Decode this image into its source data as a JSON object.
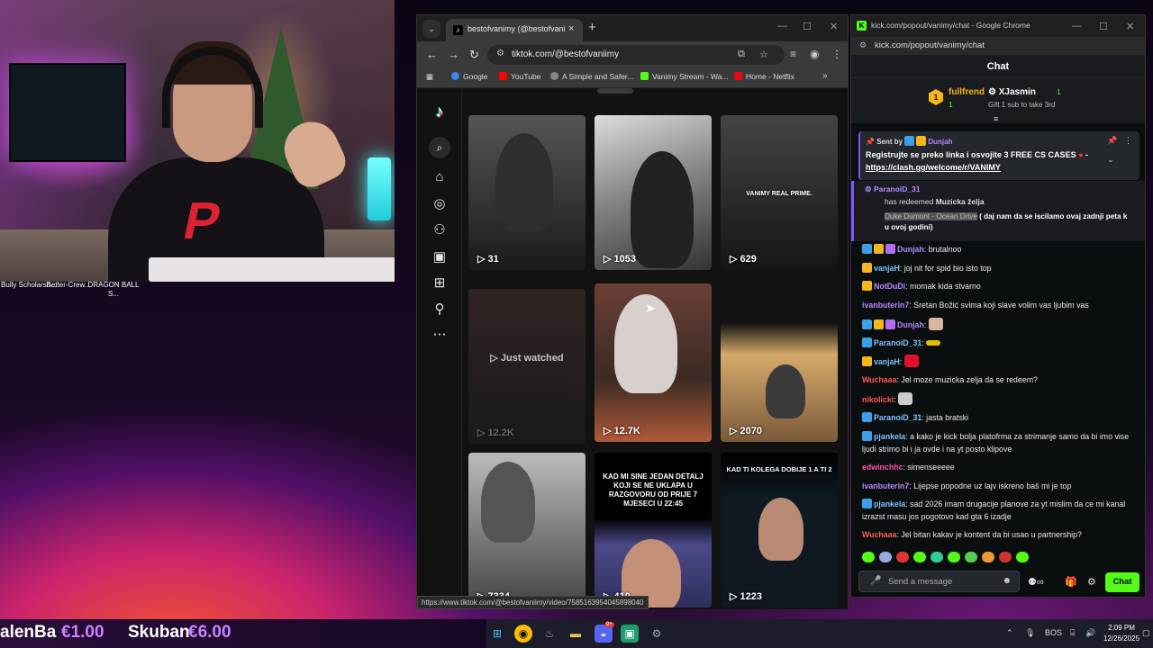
{
  "desktop": {
    "icons": [
      {
        "label": "Bully Scholarsh..."
      },
      {
        "label": "Better-Crew..."
      },
      {
        "label": "DRAGON BALL S..."
      }
    ]
  },
  "tiktok_window": {
    "tab_title": "bestofvanimy (@bestofvanimy",
    "url": "tiktok.com/@bestofvaniimy",
    "bookmarks": [
      "Google",
      "YouTube",
      "A Simple and Safer...",
      "Vanimy Stream - Wa...",
      "Home - Netflix"
    ],
    "videos": [
      {
        "views": "31",
        "overlay": ""
      },
      {
        "views": "1053",
        "overlay": ""
      },
      {
        "views": "629",
        "overlay": "VANIMY REAL PRIME."
      },
      {
        "views": "12.2K",
        "overlay": "Just watched"
      },
      {
        "views": "12.7K",
        "overlay": ""
      },
      {
        "views": "2070",
        "overlay": ""
      },
      {
        "views": "7334",
        "overlay": ""
      },
      {
        "views": "410",
        "overlay": "KAD MI SINE JEDAN DETALJ KOJI SE NE UKLAPA U RAZGOVORU OD PRIJE 7 MJESECI U 22:45"
      },
      {
        "views": "1223",
        "overlay": "KAD TI KOLEGA DOBIJE 1 A TI 2"
      }
    ],
    "status_url": "https://www.tiktok.com/@bestofvaniimy/video/7585163954045898040"
  },
  "kick_window": {
    "title": "kick.com/popout/vanimy/chat - Google Chrome",
    "url": "kick.com/popout/vanimy/chat",
    "chat_header": "Chat",
    "leaderboard": {
      "first": {
        "rank": "1",
        "name": "fullfrend",
        "count": "1"
      },
      "second": {
        "name": "XJasmin",
        "count": "1"
      },
      "gift_text": "Gift 1 sub to take 3rd"
    },
    "pinned": {
      "sent_by_label": "Sent by",
      "user": "Dunjah",
      "message": "Registrujte se preko linka i osvojite 3 FREE CS CASES",
      "link": "https://clash.gg/welcome/r/VANIMY"
    },
    "redeem": {
      "user": "ParanoiD_31",
      "action": "has redeemed",
      "reward": "Muzicka želja",
      "song": "Duke Dumont - Ocean Drive",
      "note": "( daj nam da se iscilamo ovaj zadnji peta k u ovoj godini)"
    },
    "messages": [
      {
        "user": "Dunjah",
        "text": ": brutalnoo",
        "color": "#b389ff"
      },
      {
        "user": "vanjaH",
        "text": ": joj nit for spid bio isto top",
        "color": "#7ec1ff"
      },
      {
        "user": "NotDuDi",
        "text": ": momak kida stvarno",
        "color": "#b389ff"
      },
      {
        "user": "ivanbuterin7",
        "text": ": Sretan Božić svima koji slave volim vas ljubim vas",
        "color": "#b389ff"
      },
      {
        "user": "Dunjah",
        "text": ":",
        "color": "#b389ff"
      },
      {
        "user": "ParanoiD_31",
        "text": ":",
        "color": "#7ec1ff"
      },
      {
        "user": "vanjaH",
        "text": ":",
        "color": "#7ec1ff"
      },
      {
        "user": "Wuchaaa",
        "text": ": Jel moze muzicka zelja da se redeem?",
        "color": "#ff5a5a"
      },
      {
        "user": "nikolicki",
        "text": ":",
        "color": "#ff5a5a"
      },
      {
        "user": "ParanoiD_31",
        "text": ": jasta bratski",
        "color": "#7ec1ff"
      },
      {
        "user": "pjankela",
        "text": ": a kako je kick bolja platofrma za strimanje samo da bi imo vise ljudi strimo bi i ja ovde i na yt posto klipove",
        "color": "#7ec1ff"
      },
      {
        "user": "edwinchhc",
        "text": ": simenseeeee",
        "color": "#ff4fa8"
      },
      {
        "user": "ivanbuterin7",
        "text": ": Lijepse popodne uz lajv iskreno baš mi je top",
        "color": "#b389ff"
      },
      {
        "user": "pjankela",
        "text": ": sad 2026 imam drugacije planove za yt mislim da ce mi kanal izrazst masu jos pogotovo kad gta 6 izadje",
        "color": "#7ec1ff"
      },
      {
        "user": "Wuchaaa",
        "text": ": Jel bitan kakav je kontent da bi usao u partnership?",
        "color": "#ff5a5a"
      }
    ],
    "input_placeholder": "Send a message",
    "chat_button": "Chat"
  },
  "ticker": {
    "items": [
      {
        "name": "alenBa",
        "amount": "€1.00"
      },
      {
        "name": "Skuban",
        "amount": "€6.00"
      }
    ]
  },
  "taskbar": {
    "language": "BOS",
    "time": "2:09 PM",
    "date": "12/26/2025",
    "discord_badge": "9+"
  }
}
